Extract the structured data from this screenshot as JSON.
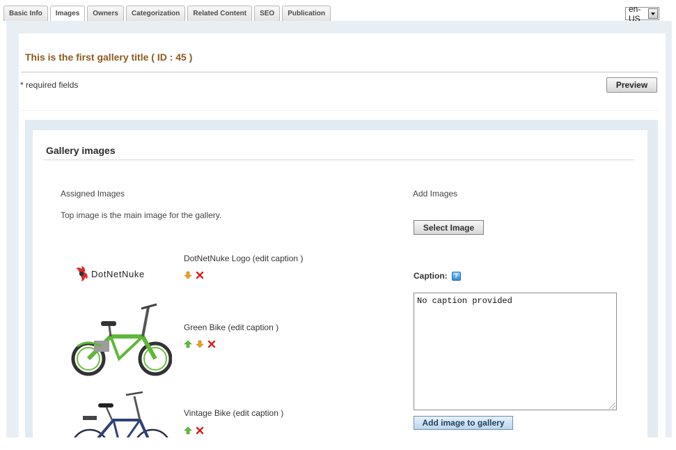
{
  "tabs": [
    "Basic Info",
    "Images",
    "Owners",
    "Categorization",
    "Related Content",
    "SEO",
    "Publication"
  ],
  "active_tab": "Images",
  "language": {
    "value": "en-US"
  },
  "page": {
    "title": "This is the first gallery title ( ID : 45 )",
    "required_note": "* required fields",
    "preview_label": "Preview"
  },
  "gallery": {
    "section_title": "Gallery images",
    "assigned_heading": "Assigned Images",
    "assigned_note": "Top image is the main image for the gallery.",
    "add_heading": "Add Images",
    "select_label": "Select Image",
    "caption_label": "Caption:",
    "caption_value": "No caption provided",
    "add_label": "Add image to gallery",
    "images": [
      {
        "caption": "DotNetNuke Logo",
        "edit": "(edit caption )",
        "actions": [
          "down",
          "delete"
        ],
        "logo_text": "DotNetNuke"
      },
      {
        "caption": "Green Bike",
        "edit": "(edit caption )",
        "actions": [
          "up",
          "down",
          "delete"
        ]
      },
      {
        "caption": "Vintage Bike",
        "edit": "(edit caption )",
        "actions": [
          "up",
          "delete"
        ]
      }
    ]
  },
  "colors": {
    "title": "#8a5a1c",
    "frame": "#e8eff4",
    "delete": "#d81e1e",
    "up": "#4caf2a",
    "down": "#f0a020"
  },
  "icons": {
    "help": "question-icon",
    "up": "green-up-arrow-icon",
    "down": "orange-down-arrow-icon",
    "delete": "red-x-icon"
  }
}
